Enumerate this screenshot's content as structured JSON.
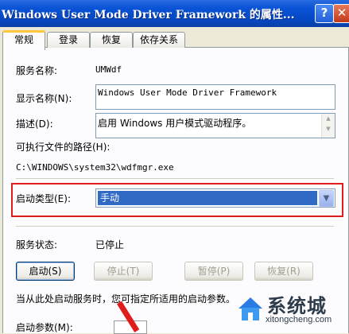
{
  "window": {
    "title": "Windows User Mode Driver Framework 的属性...",
    "help_label": "?",
    "close_label": "✕"
  },
  "tabs": [
    {
      "label": "常规",
      "active": true
    },
    {
      "label": "登录"
    },
    {
      "label": "恢复"
    },
    {
      "label": "依存关系"
    }
  ],
  "fields": {
    "service_name_label": "服务名称:",
    "service_name_value": "UMWdf",
    "display_name_label": "显示名称(N):",
    "display_name_value": "Windows User Mode Driver Framework",
    "description_label": "描述(D):",
    "description_value": "启用 Windows 用户模式驱动程序。",
    "exe_path_label": "可执行文件的路径(H):",
    "exe_path_value": "C:\\WINDOWS\\system32\\wdfmgr.exe",
    "startup_type_label": "启动类型(E):",
    "startup_type_value": "手动",
    "service_status_label": "服务状态:",
    "service_status_value": "已停止"
  },
  "buttons": {
    "start": "启动(S)",
    "stop": "停止(T)",
    "pause": "暂停(P)",
    "resume": "恢复(R)"
  },
  "hint": "当从此处启动服务时，您可指定所适用的启动参数。",
  "start_params_label": "启动参数(M):",
  "watermark": {
    "main": "系统城",
    "sub": "xitongcheng.com"
  },
  "colors": {
    "titlebar": "#0548C4",
    "selection": "#316AC5",
    "highlight_frame": "#E01D1D",
    "dialog_bg": "#ECE9D8"
  }
}
